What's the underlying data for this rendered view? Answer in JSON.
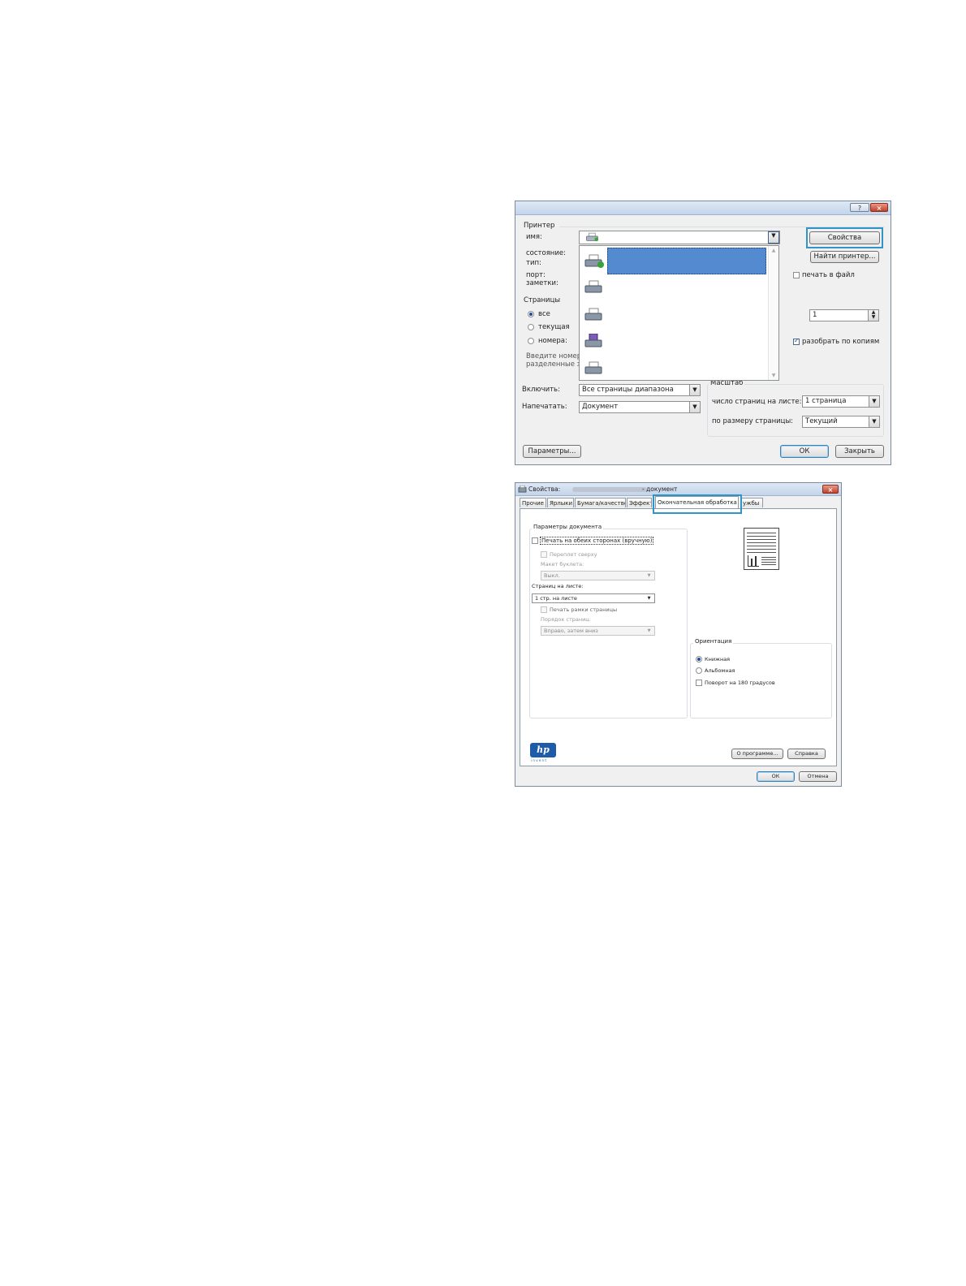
{
  "print_dialog": {
    "help_button": "?",
    "close_button": "×",
    "printer_group": "Принтер",
    "name_label": "имя:",
    "status_label": "состояние:",
    "type_label": "тип:",
    "port_label": "порт:",
    "notes_label": "заметки:",
    "properties_button": "Свойства",
    "find_printer_button": "Найти принтер...",
    "print_to_file_label": "печать в файл",
    "pages_group": "Страницы",
    "pages_all": "все",
    "pages_current": "текущая",
    "pages_numbers": "номера:",
    "pages_hint_line1": "Введите номер",
    "pages_hint_line2": "разделенные з",
    "copies_value": "1",
    "collate_label": "разобрать по копиям",
    "include_label": "Включить:",
    "include_value": "Все страницы диапазона",
    "print_what_label": "Напечатать:",
    "print_what_value": "Документ",
    "scale_group": "Масштаб",
    "pages_per_sheet_label": "число страниц на листе:",
    "pages_per_sheet_value": "1 страница",
    "scale_to_paper_label": "по размеру страницы:",
    "scale_to_paper_value": "Текущий",
    "options_button": "Параметры...",
    "ok_button": "ОК",
    "close_dialog_button": "Закрыть"
  },
  "properties_dialog": {
    "title_prefix": "Свойства:",
    "title_suffix": "- документ",
    "close_button": "×",
    "tabs": [
      "Прочие",
      "Ярлыки",
      "Бумага/качество",
      "Эффект",
      "Окончательная обработка",
      "ужбы"
    ],
    "doc_options_group": "Параметры документа",
    "duplex_label": "Печать на обеих сторонах (вручную)",
    "flip_up_label": "Переплет сверху",
    "booklet_label": "Макет буклета:",
    "booklet_value": "Выкл.",
    "pages_per_sheet_label": "Страниц на листе:",
    "pages_per_sheet_value": "1 стр. на листе",
    "borders_label": "Печать рамки страницы",
    "page_order_label": "Порядок страниц:",
    "page_order_value": "Вправо, затем вниз",
    "orientation_group": "Ориентация",
    "portrait_label": "Книжная",
    "landscape_label": "Альбомная",
    "rotate_label": "Поворот на 180 градусов",
    "logo_text": "hp",
    "logo_tagline": "i n v e n t",
    "about_button": "О программе...",
    "help_button": "Справка",
    "ok_button": "ОК",
    "cancel_button": "Отмена"
  }
}
